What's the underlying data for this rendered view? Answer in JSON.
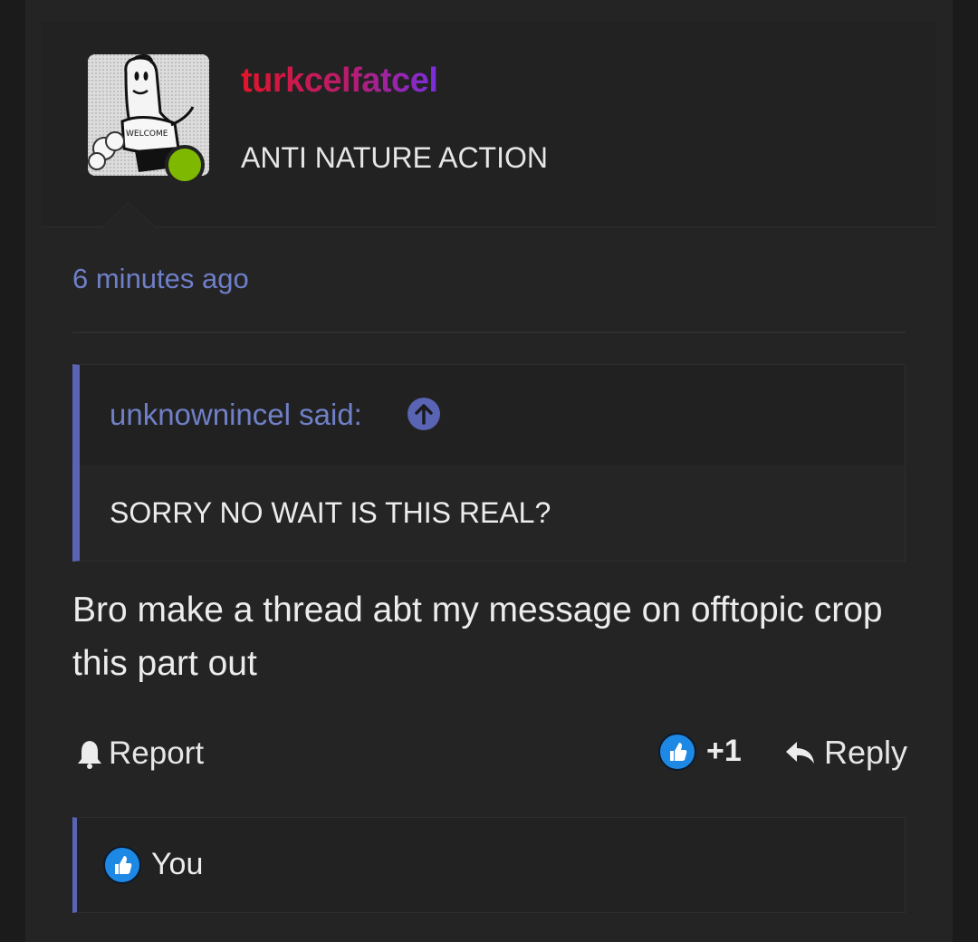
{
  "user": {
    "name": "turkcelfatcel",
    "title": "ANTI NATURE ACTION",
    "avatar_text": "WELCOME",
    "online_color": "#7fb800"
  },
  "post": {
    "timestamp": "6 minutes ago",
    "quote": {
      "author": "unknownincel said:",
      "text": "SORRY NO WAIT IS THIS REAL?"
    },
    "message": "Bro make a thread abt my message on offtopic crop this part out"
  },
  "actions": {
    "report_label": "Report",
    "like_count": "+1",
    "reply_label": "Reply"
  },
  "reactions": {
    "users": "You"
  },
  "colors": {
    "accent": "#5a64b4",
    "link": "#6f7fc9",
    "like": "#1e88e5"
  }
}
